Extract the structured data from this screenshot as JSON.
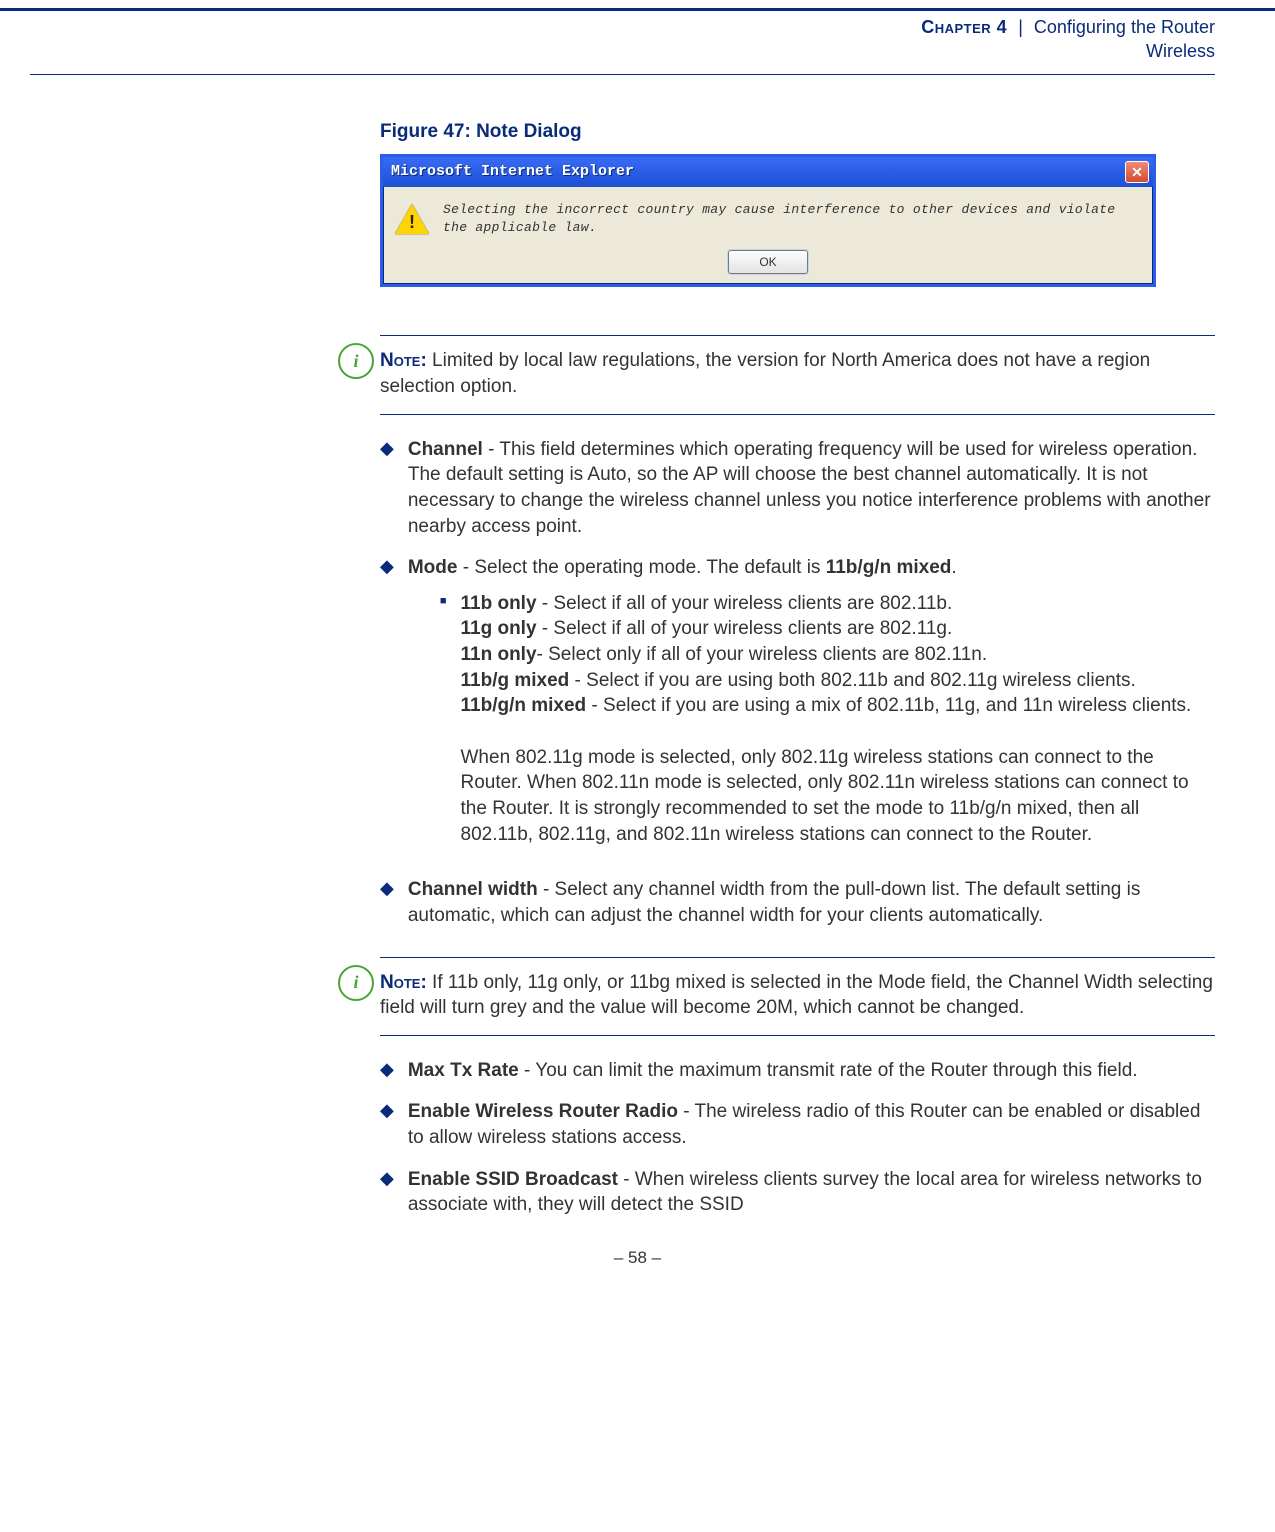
{
  "header": {
    "chapter_label": "Chapter 4",
    "chapter_title": "Configuring the Router",
    "sub": "Wireless"
  },
  "figure": {
    "caption": "Figure 47:  Note Dialog"
  },
  "dialog": {
    "title": "Microsoft Internet Explorer",
    "message": "Selecting the incorrect country may cause interference to other devices and violate the applicable law.",
    "ok": "OK"
  },
  "note1": {
    "label": "Note:",
    "text": " Limited by local law regulations, the version for North America does not have a region selection option."
  },
  "channel": {
    "term": "Channel",
    "desc": " - This field determines which operating frequency will be used for wireless operation. The default setting is Auto, so the AP will choose the best channel automatically. It is not necessary to change the wireless channel unless you notice interference problems with another nearby access point."
  },
  "mode": {
    "term": "Mode",
    "desc_pre": " - Select the operating mode. The default is ",
    "default": "11b/g/n mixed",
    "desc_post": ".",
    "sub": {
      "b_term": "11b only",
      "b_desc": " - Select if all of your wireless clients are 802.11b.",
      "g_term": "11g only",
      "g_desc": " - Select if all of your wireless clients are 802.11g.",
      "n_term": "11n only",
      "n_desc": "- Select only if all of your wireless clients are 802.11n.",
      "bg_term": "11b/g mixed",
      "bg_desc": " - Select if you are using both 802.11b and 802.11g wireless clients.",
      "bgn_term": "11b/g/n mixed",
      "bgn_desc": " - Select if you are using a mix of 802.11b, 11g, and 11n wireless clients.",
      "para": "When 802.11g mode is selected, only 802.11g wireless stations can connect to the Router. When 802.11n mode is selected, only 802.11n wireless stations can connect to the Router. It is strongly recommended to set the mode to 11b/g/n mixed, then all 802.11b, 802.11g, and 802.11n wireless stations can connect to the Router."
    }
  },
  "cw": {
    "term": "Channel width",
    "desc": " - Select any channel width from the pull-down list. The default setting is automatic, which can adjust the channel width for your clients automatically."
  },
  "note2": {
    "label": "Note:",
    "text": " If 11b only, 11g only, or 11bg mixed is selected in the Mode field, the Channel Width selecting field will turn grey and the value will become 20M, which cannot be changed."
  },
  "maxtx": {
    "term": "Max Tx Rate",
    "desc": " - You can limit the maximum transmit rate of the Router through this field."
  },
  "radio": {
    "term": "Enable Wireless Router Radio",
    "desc": " - The wireless radio of this Router can be enabled or disabled to allow wireless stations access."
  },
  "ssid": {
    "term": "Enable SSID Broadcast",
    "desc": " - When wireless clients survey the local area for wireless networks to associate with, they will detect the SSID"
  },
  "page_num": "–  58  –"
}
